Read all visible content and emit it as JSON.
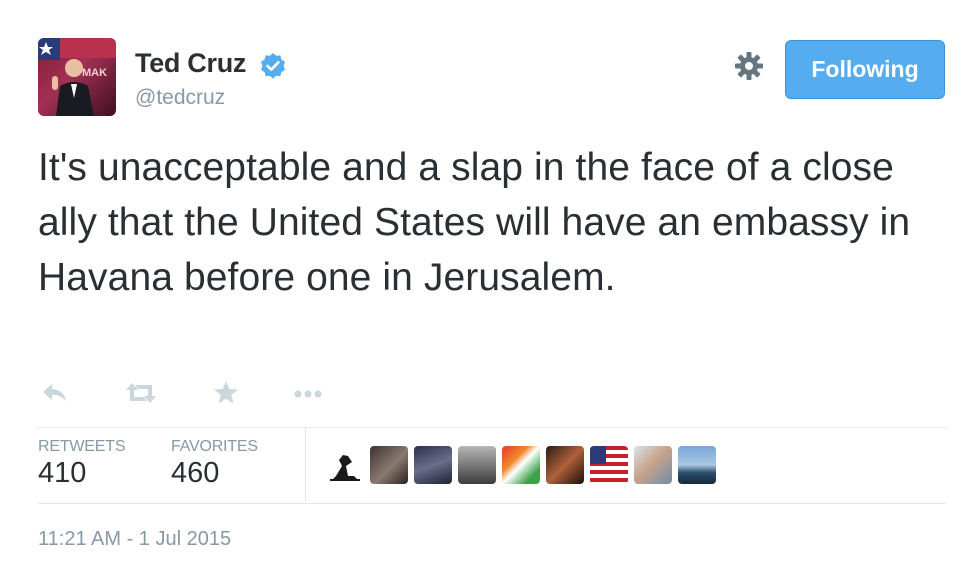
{
  "author": {
    "name": "Ted Cruz",
    "handle": "@tedcruz",
    "avatar_icon": "profile-photo"
  },
  "header": {
    "gear_icon": "gear-icon",
    "follow_button_label": "Following",
    "follow_button_color": "#55acee"
  },
  "tweet": {
    "text": "It's unacceptable and a slap in the face of a close ally that the United States will have an embassy in Havana before one in Jerusalem."
  },
  "actions": [
    {
      "icon": "reply-icon"
    },
    {
      "icon": "retweet-icon"
    },
    {
      "icon": "favorite-star-icon"
    },
    {
      "icon": "more-dots-icon"
    }
  ],
  "stats": {
    "retweets_label": "RETWEETS",
    "retweets_count": "410",
    "favorites_label": "FAVORITES",
    "favorites_count": "460"
  },
  "favoriters": [
    {
      "icon": "favoriter-avatar-1"
    },
    {
      "icon": "favoriter-avatar-2"
    },
    {
      "icon": "favoriter-avatar-3"
    },
    {
      "icon": "favoriter-avatar-4"
    },
    {
      "icon": "favoriter-avatar-5"
    },
    {
      "icon": "favoriter-avatar-6"
    },
    {
      "icon": "favoriter-avatar-7"
    },
    {
      "icon": "favoriter-avatar-8"
    },
    {
      "icon": "favoriter-avatar-9"
    }
  ],
  "timestamp": "11:21 AM - 1 Jul 2015",
  "colors": {
    "text": "#292f33",
    "muted": "#8899a6",
    "accent": "#55acee",
    "border": "#e1e8ed"
  }
}
